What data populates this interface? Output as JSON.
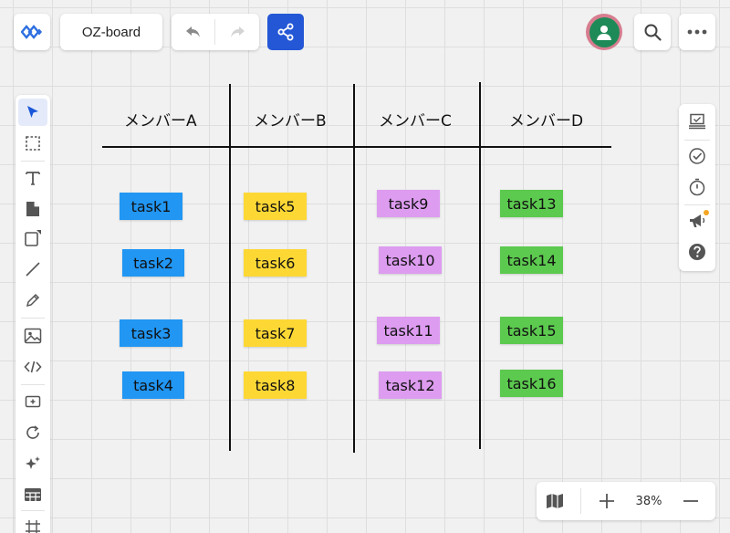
{
  "app": {
    "board_title": "OZ-board",
    "logo_icon": "app-logo-icon"
  },
  "toolbar_top": {
    "undo_icon": "undo-icon",
    "redo_icon": "redo-icon",
    "share_icon": "share-icon",
    "share_color": "#2457d6",
    "avatar_icon": "user-avatar-icon",
    "avatar_color": "#1e8a57",
    "search_icon": "search-icon",
    "more_icon": "more-icon"
  },
  "left_tools": [
    {
      "icon": "select-arrow-icon",
      "active": true
    },
    {
      "icon": "frame-select-icon"
    },
    {
      "icon": "text-icon"
    },
    {
      "icon": "sticky-note-icon"
    },
    {
      "icon": "shape-icon"
    },
    {
      "icon": "line-icon"
    },
    {
      "icon": "pen-icon"
    },
    {
      "icon": "image-icon"
    },
    {
      "icon": "code-icon"
    },
    {
      "icon": "card-add-icon"
    },
    {
      "icon": "loop-icon"
    },
    {
      "icon": "ai-sparkle-icon"
    },
    {
      "icon": "table-icon"
    },
    {
      "icon": "grid-frame-icon"
    }
  ],
  "right_tools": [
    {
      "icon": "presentation-icon"
    },
    {
      "icon": "check-circle-icon"
    },
    {
      "icon": "timer-icon"
    },
    {
      "icon": "megaphone-icon",
      "badge": true
    },
    {
      "icon": "help-icon"
    }
  ],
  "zoom": {
    "map_icon": "map-icon",
    "zoom_in_icon": "plus-icon",
    "level": "38%",
    "zoom_out_icon": "minus-icon"
  },
  "board": {
    "columns": [
      "メンバーA",
      "メンバーB",
      "メンバーC",
      "メンバーD"
    ],
    "notes": [
      {
        "label": "task1",
        "color": "#2196f3"
      },
      {
        "label": "task2",
        "color": "#2196f3"
      },
      {
        "label": "task3",
        "color": "#2196f3"
      },
      {
        "label": "task4",
        "color": "#2196f3"
      },
      {
        "label": "task5",
        "color": "#fdd835"
      },
      {
        "label": "task6",
        "color": "#fdd835"
      },
      {
        "label": "task7",
        "color": "#fdd835"
      },
      {
        "label": "task8",
        "color": "#fdd835"
      },
      {
        "label": "task9",
        "color": "#dd9cf0"
      },
      {
        "label": "task10",
        "color": "#dd9cf0"
      },
      {
        "label": "task11",
        "color": "#dd9cf0"
      },
      {
        "label": "task12",
        "color": "#dd9cf0"
      },
      {
        "label": "task13",
        "color": "#5cc94f"
      },
      {
        "label": "task14",
        "color": "#5cc94f"
      },
      {
        "label": "task15",
        "color": "#5cc94f"
      },
      {
        "label": "task16",
        "color": "#5cc94f"
      }
    ]
  }
}
